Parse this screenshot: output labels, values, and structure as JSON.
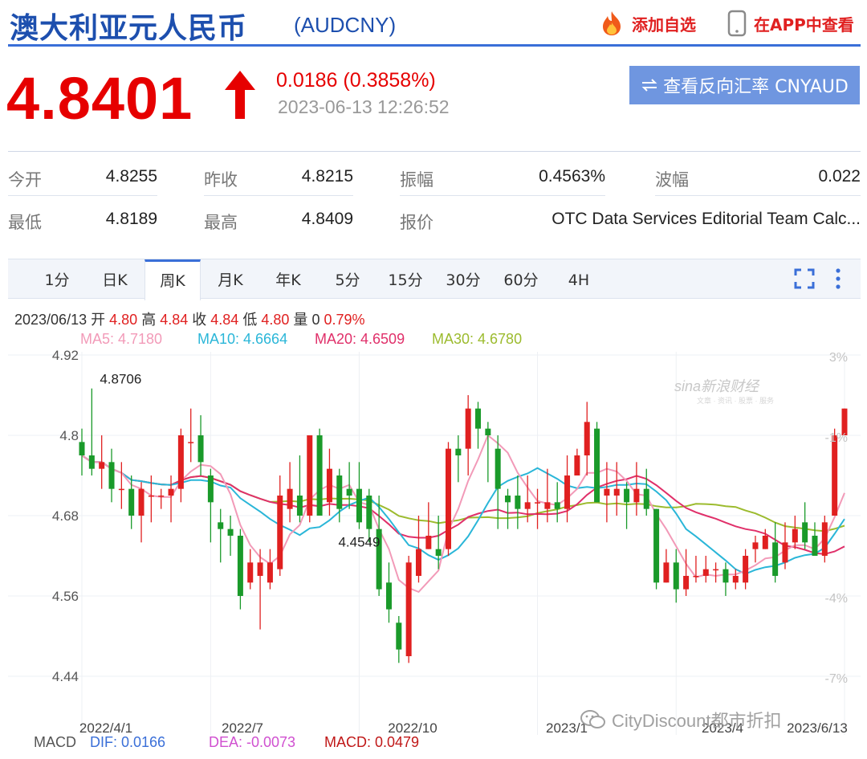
{
  "header": {
    "title": "澳大利亚元人民币",
    "code": "(AUDCNY)",
    "add_favorite": "添加自选",
    "view_in_app": "在APP中查看"
  },
  "quote": {
    "price": "4.8401",
    "change": "0.0186 (0.3858%)",
    "time": "2023-06-13 12:26:52",
    "reverse_button": "查看反向汇率 CNYAUD",
    "direction": "up",
    "up_color": "#e60000"
  },
  "stats": {
    "open_label": "今开",
    "open": "4.8255",
    "prev_close_label": "昨收",
    "prev_close": "4.8215",
    "amplitude_label": "振幅",
    "amplitude": "0.4563%",
    "wave_label": "波幅",
    "wave": "0.022",
    "low_label": "最低",
    "low": "4.8189",
    "high_label": "最高",
    "high": "4.8409",
    "quote_source_label": "报价",
    "quote_source": "OTC Data Services Editorial Team Calc..."
  },
  "tabs": [
    "1分",
    "日K",
    "周K",
    "月K",
    "年K",
    "5分",
    "15分",
    "30分",
    "60分",
    "4H"
  ],
  "active_tab": "周K",
  "bar_info": {
    "date": "2023/06/13",
    "open_label": "开",
    "open": "4.80",
    "high_label": "高",
    "high": "4.84",
    "close_label": "收",
    "close": "4.84",
    "low_label": "低",
    "low": "4.80",
    "volume_label": "量",
    "volume": "0",
    "pct": "0.79%"
  },
  "ma_labels": {
    "ma5": "MA5: 4.7180",
    "ma10": "MA10: 4.6664",
    "ma20": "MA20: 4.6509",
    "ma30": "MA30: 4.6780"
  },
  "macd_labels": {
    "macd": "MACD",
    "dif": "DIF: 0.0166",
    "dea": "DEA: -0.0073",
    "macd_value": "MACD: 0.0479"
  },
  "watermark": {
    "sina": "sina新浪财经",
    "sina_tagline": "文章 · 资讯 · 股票 · 服务",
    "wechat": "CityDiscount都市折扣"
  },
  "colors": {
    "up": "#e02020",
    "down": "#1a9a2a",
    "ma5": "#f29ab8",
    "ma10": "#2ab6d8",
    "ma20": "#e0306a",
    "ma30": "#9cbb2e",
    "accent": "#3a6fd8"
  },
  "chart_data": {
    "type": "candlestick",
    "title": "",
    "y_axis_ticks": [
      "4.92",
      "4.8",
      "4.68",
      "4.56",
      "4.44"
    ],
    "pct_axis_ticks": [
      "3%",
      "-1%",
      "-4%",
      "-7%"
    ],
    "x_axis_ticks": [
      "2022/4/1",
      "2022/7",
      "2022/10",
      "2023/1",
      "2023/4",
      "2023/6/13"
    ],
    "ylim": [
      4.44,
      4.92
    ],
    "annotations": [
      {
        "text": "4.8706",
        "bar_index": 1
      },
      {
        "text": "4.4549",
        "bar_index": 28
      }
    ],
    "candles": [
      [
        4.79,
        4.77,
        4.81,
        4.74
      ],
      [
        4.77,
        4.75,
        4.87,
        4.74
      ],
      [
        4.75,
        4.76,
        4.8,
        4.72
      ],
      [
        4.76,
        4.72,
        4.78,
        4.7
      ],
      [
        4.72,
        4.72,
        4.76,
        4.69
      ],
      [
        4.72,
        4.68,
        4.74,
        4.66
      ],
      [
        4.68,
        4.72,
        4.73,
        4.64
      ],
      [
        4.71,
        4.71,
        4.74,
        4.67
      ],
      [
        4.71,
        4.71,
        4.72,
        4.69
      ],
      [
        4.71,
        4.72,
        4.74,
        4.67
      ],
      [
        4.72,
        4.8,
        4.81,
        4.7
      ],
      [
        4.79,
        4.79,
        4.84,
        4.76
      ],
      [
        4.8,
        4.76,
        4.83,
        4.74
      ],
      [
        4.74,
        4.7,
        4.75,
        4.64
      ],
      [
        4.67,
        4.66,
        4.69,
        4.61
      ],
      [
        4.66,
        4.65,
        4.68,
        4.62
      ],
      [
        4.65,
        4.56,
        4.66,
        4.54
      ],
      [
        4.58,
        4.61,
        4.63,
        4.57
      ],
      [
        4.59,
        4.61,
        4.63,
        4.51
      ],
      [
        4.58,
        4.61,
        4.63,
        4.57
      ],
      [
        4.6,
        4.71,
        4.74,
        4.59
      ],
      [
        4.69,
        4.72,
        4.76,
        4.67
      ],
      [
        4.71,
        4.68,
        4.77,
        4.67
      ],
      [
        4.68,
        4.8,
        4.8,
        4.67
      ],
      [
        4.8,
        4.68,
        4.81,
        4.68
      ],
      [
        4.7,
        4.75,
        4.78,
        4.68
      ],
      [
        4.74,
        4.69,
        4.75,
        4.67
      ],
      [
        4.72,
        4.71,
        4.76,
        4.69
      ],
      [
        4.72,
        4.67,
        4.76,
        4.66
      ],
      [
        4.71,
        4.66,
        4.72,
        4.64
      ],
      [
        4.66,
        4.57,
        4.71,
        4.56
      ],
      [
        4.58,
        4.54,
        4.61,
        4.52
      ],
      [
        4.52,
        4.48,
        4.53,
        4.46
      ],
      [
        4.47,
        4.61,
        4.62,
        4.46
      ],
      [
        4.59,
        4.63,
        4.68,
        4.58
      ],
      [
        4.63,
        4.65,
        4.7,
        4.63
      ],
      [
        4.63,
        4.62,
        4.68,
        4.6
      ],
      [
        4.63,
        4.78,
        4.79,
        4.62
      ],
      [
        4.78,
        4.77,
        4.8,
        4.73
      ],
      [
        4.78,
        4.84,
        4.86,
        4.74
      ],
      [
        4.84,
        4.81,
        4.85,
        4.78
      ],
      [
        4.81,
        4.8,
        4.82,
        4.73
      ],
      [
        4.78,
        4.72,
        4.8,
        4.66
      ],
      [
        4.71,
        4.7,
        4.72,
        4.66
      ],
      [
        4.71,
        4.69,
        4.74,
        4.66
      ],
      [
        4.69,
        4.7,
        4.74,
        4.67
      ],
      [
        4.7,
        4.7,
        4.72,
        4.66
      ],
      [
        4.69,
        4.7,
        4.75,
        4.67
      ],
      [
        4.7,
        4.69,
        4.73,
        4.67
      ],
      [
        4.69,
        4.74,
        4.77,
        4.67
      ],
      [
        4.74,
        4.77,
        4.78,
        4.74
      ],
      [
        4.77,
        4.82,
        4.85,
        4.74
      ],
      [
        4.81,
        4.7,
        4.82,
        4.7
      ],
      [
        4.71,
        4.72,
        4.76,
        4.67
      ],
      [
        4.71,
        4.72,
        4.76,
        4.68
      ],
      [
        4.72,
        4.7,
        4.73,
        4.66
      ],
      [
        4.7,
        4.72,
        4.76,
        4.68
      ],
      [
        4.72,
        4.69,
        4.75,
        4.68
      ],
      [
        4.69,
        4.58,
        4.69,
        4.57
      ],
      [
        4.58,
        4.61,
        4.63,
        4.58
      ],
      [
        4.61,
        4.57,
        4.63,
        4.55
      ],
      [
        4.57,
        4.59,
        4.63,
        4.56
      ],
      [
        4.59,
        4.59,
        4.62,
        4.58
      ],
      [
        4.59,
        4.6,
        4.62,
        4.58
      ],
      [
        4.6,
        4.6,
        4.61,
        4.58
      ],
      [
        4.6,
        4.58,
        4.61,
        4.56
      ],
      [
        4.58,
        4.59,
        4.6,
        4.57
      ],
      [
        4.58,
        4.62,
        4.63,
        4.57
      ],
      [
        4.63,
        4.64,
        4.65,
        4.61
      ],
      [
        4.63,
        4.65,
        4.66,
        4.63
      ],
      [
        4.64,
        4.59,
        4.67,
        4.58
      ],
      [
        4.61,
        4.64,
        4.67,
        4.6
      ],
      [
        4.64,
        4.66,
        4.68,
        4.63
      ],
      [
        4.67,
        4.64,
        4.7,
        4.63
      ],
      [
        4.65,
        4.62,
        4.67,
        4.62
      ],
      [
        4.62,
        4.67,
        4.68,
        4.61
      ],
      [
        4.68,
        4.8,
        4.81,
        4.68
      ],
      [
        4.8,
        4.84,
        4.84,
        4.8
      ]
    ]
  }
}
